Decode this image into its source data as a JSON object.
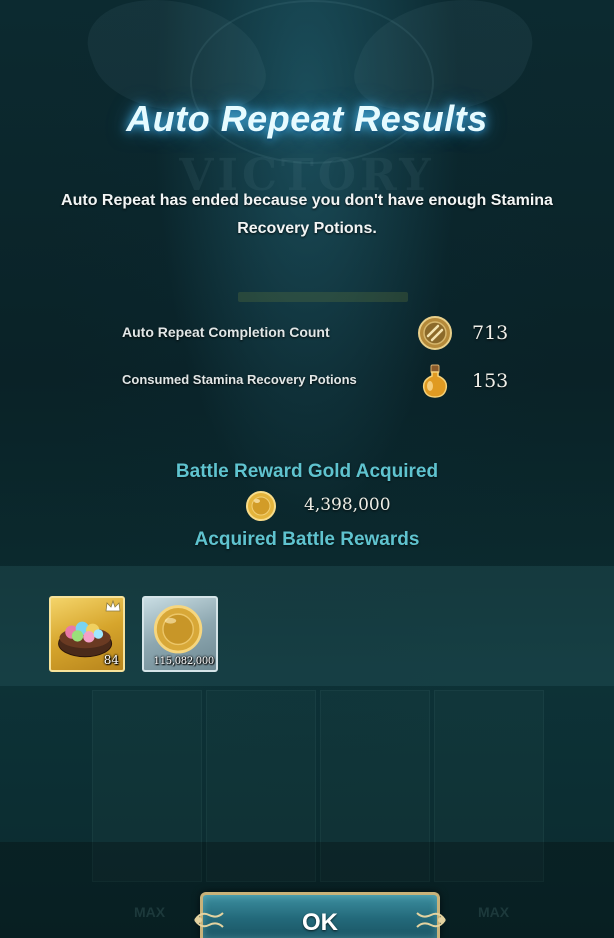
{
  "dialog": {
    "title": "Auto Repeat Results",
    "message": "Auto Repeat has ended because you don't have enough Stamina Recovery Potions."
  },
  "stats": [
    {
      "label": "Auto Repeat Completion Count",
      "icon": "repeat-medal-icon",
      "value": "713"
    },
    {
      "label": "Consumed Stamina Recovery Potions",
      "icon": "potion-icon",
      "value": "153"
    }
  ],
  "gold": {
    "title": "Battle Reward Gold Acquired",
    "icon": "gold-coin-icon",
    "value": "4,398,000"
  },
  "rewards": {
    "title": "Acquired Battle Rewards",
    "items": [
      {
        "icon": "gem-bowl-icon",
        "quantity": "84"
      },
      {
        "icon": "gold-coin-icon",
        "quantity": "115,082,000"
      }
    ]
  },
  "ok_button": {
    "label": "OK"
  },
  "background": {
    "watermark": "VICTORY",
    "max_labels": [
      "MAX",
      "MAX"
    ]
  },
  "colors": {
    "title_glow": "#50c8ff",
    "section_title": "#5fc3cf",
    "button_border": "#c8b27a"
  }
}
